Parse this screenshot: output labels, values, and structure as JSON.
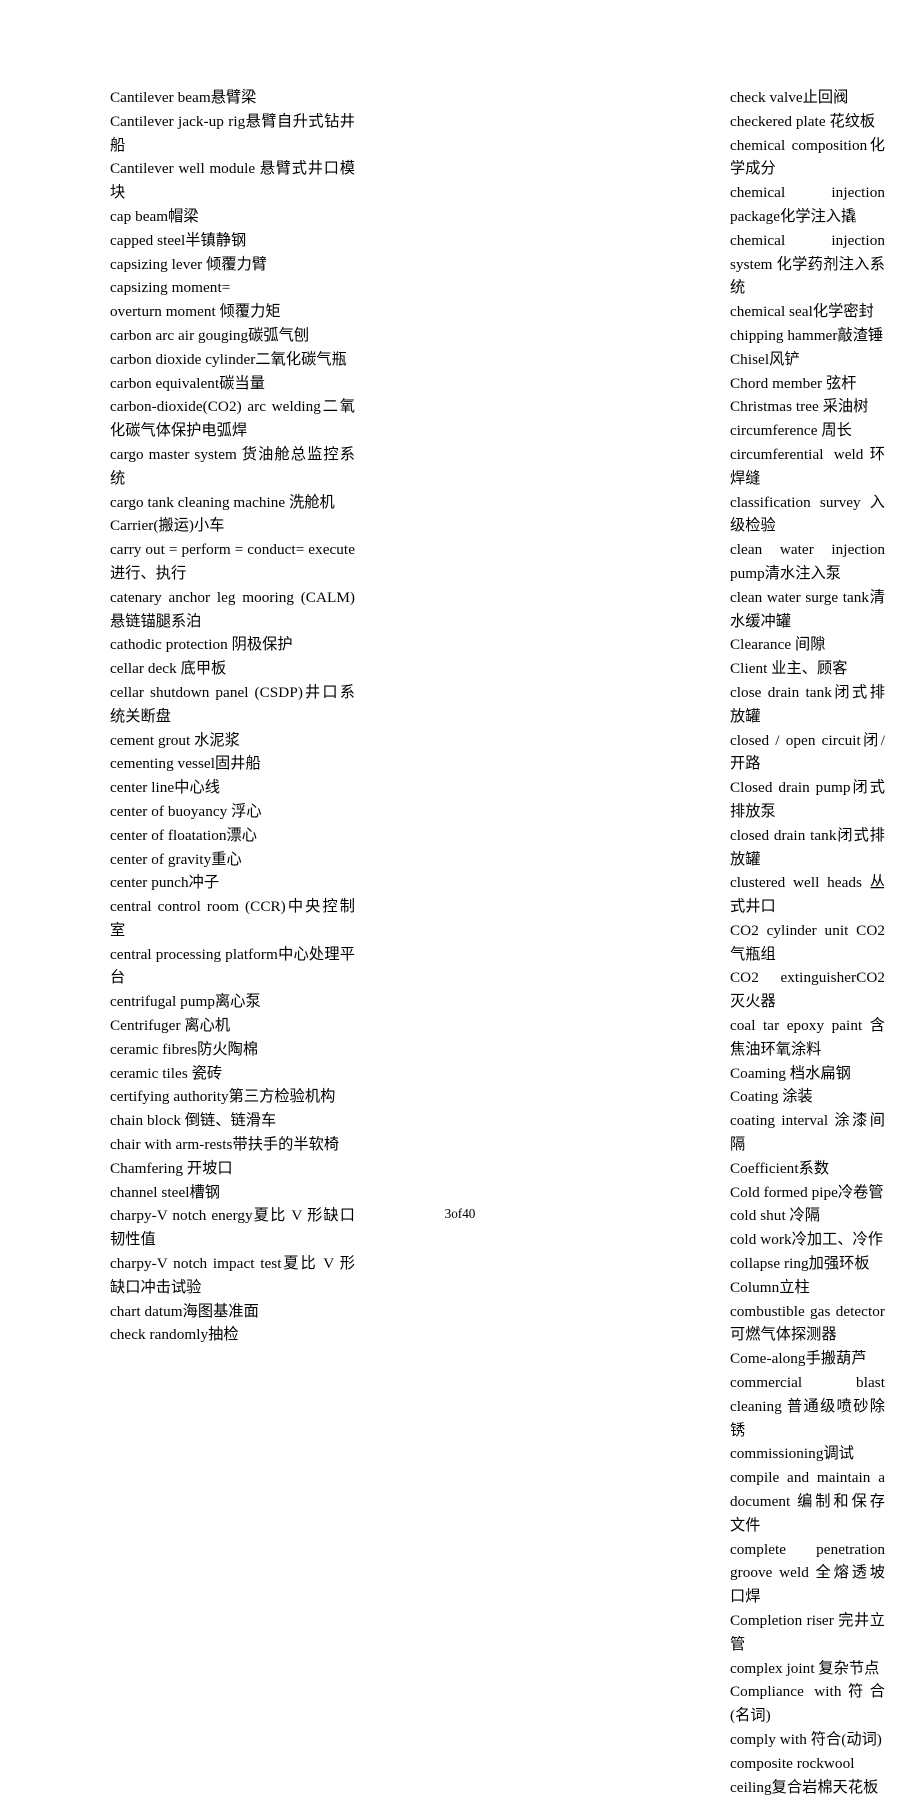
{
  "page": {
    "footer_label": "3of40",
    "text_color": "#000000",
    "background_color": "#ffffff"
  },
  "columns": {
    "left": {
      "entries": [
        "Cantilever beam悬臂梁",
        "Cantilever jack-up rig悬臂自升式钻井船",
        "Cantilever well module 悬臂式井口模块",
        "cap beam帽梁",
        "capped steel半镇静钢",
        "capsizing lever 倾覆力臂",
        "capsizing moment=",
        "overturn moment 倾覆力矩",
        "carbon arc air gouging碳弧气刨",
        "carbon dioxide cylinder二氧化碳气瓶",
        "carbon equivalent碳当量",
        "carbon-dioxide(CO2) arc welding二氧化碳气体保护电弧焊",
        "cargo master system 货油舱总监控系统",
        "cargo tank cleaning machine 洗舱机",
        "Carrier(搬运)小车",
        "carry out = perform = conduct= execute 进行、执行",
        "catenary anchor leg mooring (CALM) 悬链锚腿系泊",
        "cathodic protection 阴极保护",
        "cellar deck 底甲板",
        "cellar shutdown panel (CSDP)井口系统关断盘",
        "cement grout 水泥浆",
        "cementing vessel固井船",
        "center line中心线",
        "center of buoyancy 浮心",
        "center of floatation漂心",
        "center of gravity重心",
        "center punch冲子",
        "central control room (CCR)中央控制室",
        "central processing platform中心处理平台",
        "centrifugal pump离心泵",
        "Centrifuger 离心机",
        "ceramic fibres防火陶棉",
        "ceramic tiles 瓷砖",
        "certifying authority第三方检验机构",
        "chain block 倒链、链滑车",
        "chair with arm-rests带扶手的半软椅",
        "Chamfering 开坡口",
        "channel steel槽钢",
        "charpy-V notch energy夏比 V 形缺口韧性值",
        "charpy-V notch impact test夏比 V 形缺口冲击试验",
        "chart datum海图基准面",
        "check randomly抽检"
      ]
    },
    "right": {
      "entries": [
        "check valve止回阀",
        "checkered plate 花纹板",
        "chemical composition化学成分",
        "chemical injection package化学注入撬",
        "chemical injection system 化学药剂注入系统",
        "chemical seal化学密封",
        "chipping hammer敲渣锤",
        "Chisel风铲",
        "Chord member 弦杆",
        "Christmas tree 采油树",
        "circumference  周长",
        "circumferential weld环焊缝",
        "classification survey 入级检验",
        "clean water injection pump清水注入泵",
        "clean water surge tank清水缓冲罐",
        "Clearance  间隙",
        "Client 业主、顾客",
        "close drain tank闭式排放罐",
        "closed / open circuit闭/开路",
        "Closed drain pump闭式排放泵",
        "closed drain tank闭式排放罐",
        "clustered well heads 丛式井口",
        "CO2 cylinder unit CO2  气瓶组",
        "CO2 extinguisherCO2  灭火器",
        "coal tar epoxy paint  含焦油环氧涂料",
        "Coaming  档水扁钢",
        "Coating 涂装",
        "coating interval 涂漆间隔",
        "Coefficient系数",
        "Cold formed pipe冷卷管",
        "cold shut 冷隔",
        "cold work冷加工、冷作",
        "collapse ring加强环板",
        "Column立柱",
        "combustible gas detector 可燃气体探测器",
        "Come-along手搬葫芦",
        "commercial blast cleaning 普通级喷砂除锈",
        "commissioning调试",
        "compile and maintain a document 编制和保存文件",
        "complete penetration groove weld 全熔透坡口焊",
        "Completion riser 完井立管",
        "complex joint 复杂节点",
        "Compliance with符合(名词)",
        "comply with 符合(动词)",
        "composite rockwool ceiling复合岩棉天花板"
      ]
    }
  }
}
